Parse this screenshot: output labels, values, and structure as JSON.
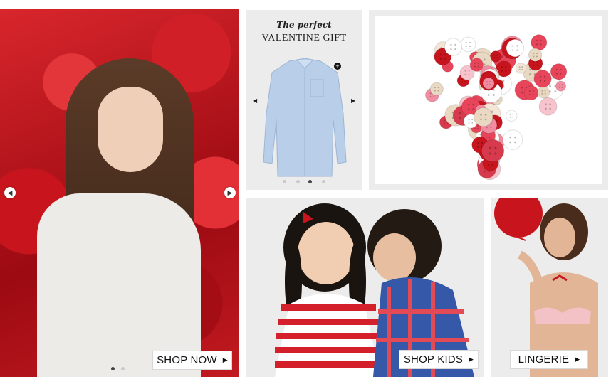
{
  "hero": {
    "shop_label": "SHOP NOW"
  },
  "shirt_tile": {
    "title_line1": "The perfect",
    "title_line2": "VALENTINE GIFT",
    "active_dot": 3,
    "dot_count": 4
  },
  "kids_tile": {
    "shop_label": "SHOP KIDS"
  },
  "lingerie_tile": {
    "shop_label": "LINGERIE"
  },
  "hero_carousel": {
    "active_dot": 1,
    "dot_count": 2
  },
  "colors": {
    "accent_red": "#c8141c",
    "tile_gray": "#ececec",
    "button_border": "#d8d8d8"
  }
}
